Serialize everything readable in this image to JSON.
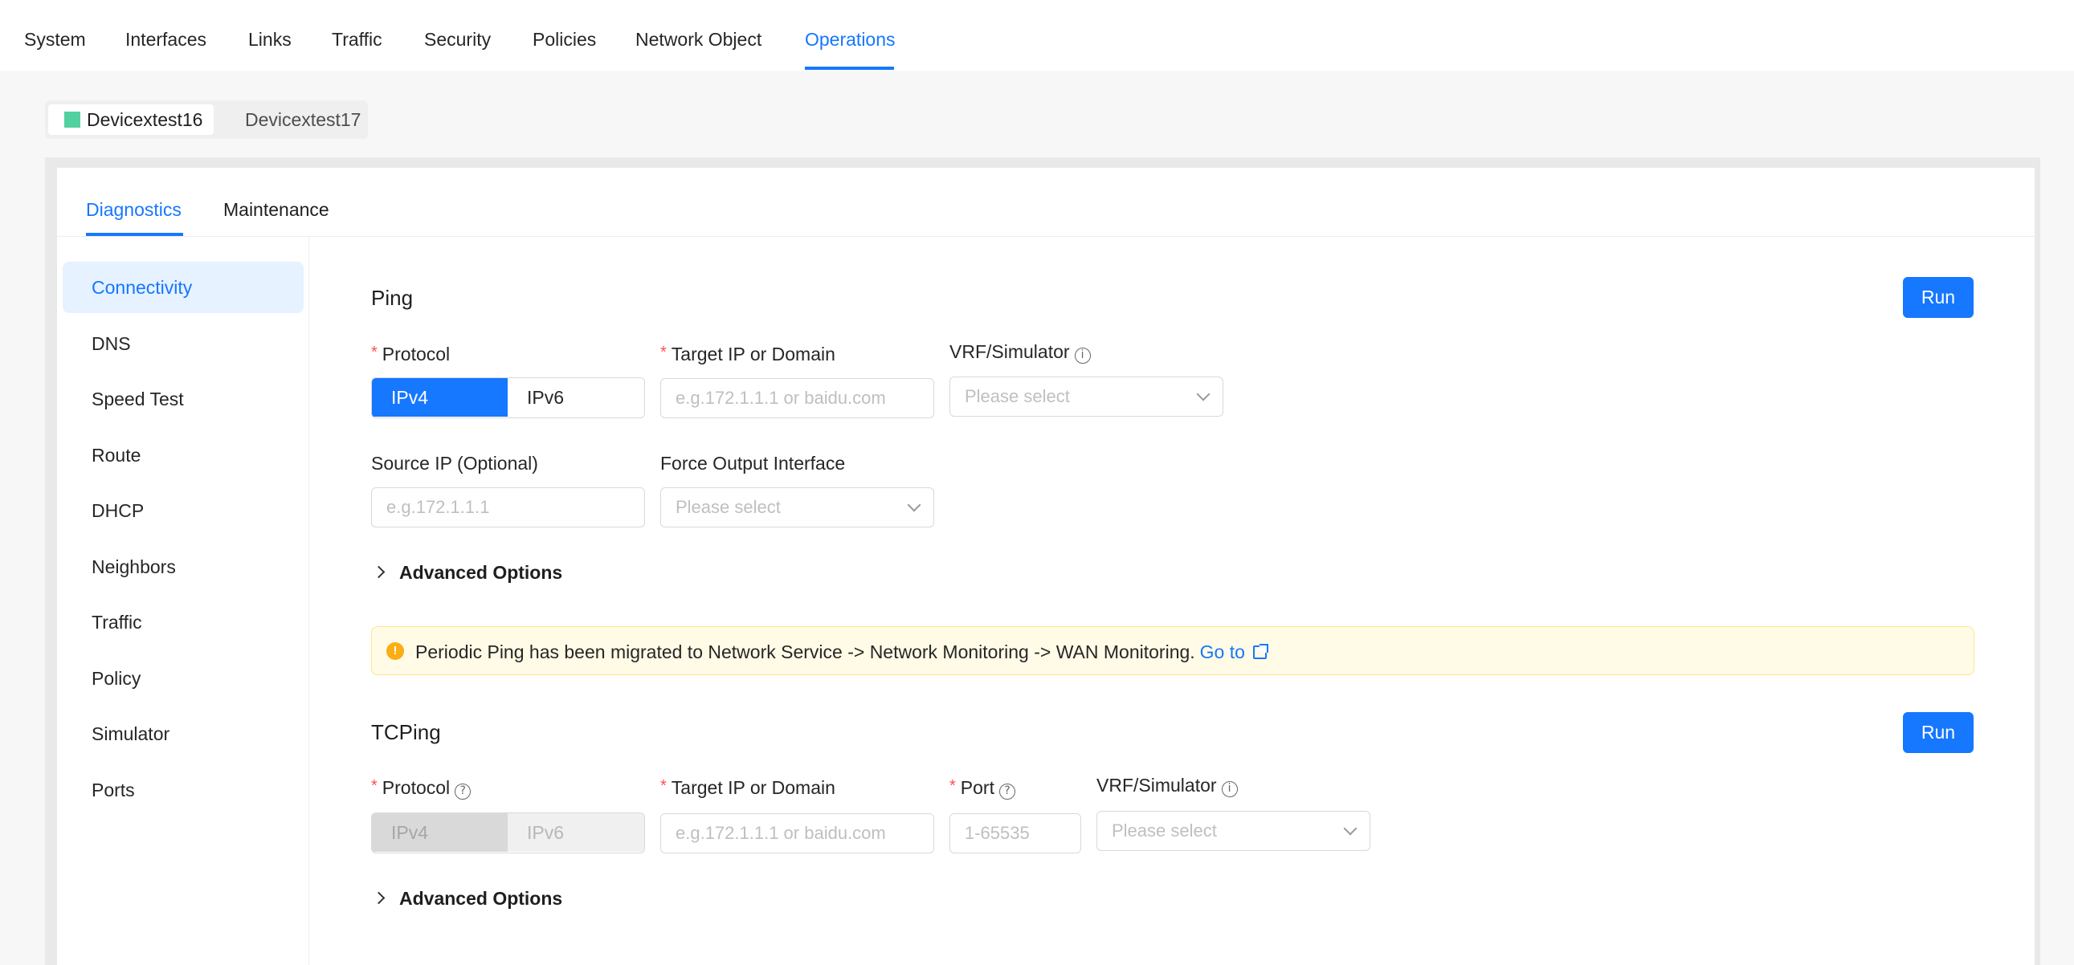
{
  "topnav": {
    "items": [
      "System",
      "Interfaces",
      "Links",
      "Traffic",
      "Security",
      "Policies",
      "Network Object",
      "Operations"
    ],
    "active": "Operations"
  },
  "devices": [
    "Devicextest16",
    "Devicextest17"
  ],
  "subtabs": [
    "Diagnostics",
    "Maintenance"
  ],
  "sidebar": [
    "Connectivity",
    "DNS",
    "Speed Test",
    "Route",
    "DHCP",
    "Neighbors",
    "Traffic",
    "Policy",
    "Simulator",
    "Ports"
  ],
  "ping": {
    "title": "Ping",
    "run": "Run",
    "protocol_label": "Protocol",
    "protocol_options": [
      "IPv4",
      "IPv6"
    ],
    "protocol_selected": "IPv4",
    "target_label": "Target IP or Domain",
    "target_placeholder": "e.g.172.1.1.1 or baidu.com",
    "vrf_label": "VRF/Simulator",
    "vrf_placeholder": "Please select",
    "source_label": "Source IP (Optional)",
    "source_placeholder": "e.g.172.1.1.1",
    "force_label": "Force Output Interface",
    "force_placeholder": "Please select",
    "advanced": "Advanced Options"
  },
  "alert": {
    "text": "Periodic Ping has been migrated to Network Service -> Network Monitoring -> WAN Monitoring.",
    "link": "Go to"
  },
  "tcping": {
    "title": "TCPing",
    "run": "Run",
    "protocol_label": "Protocol",
    "protocol_options": [
      "IPv4",
      "IPv6"
    ],
    "target_label": "Target IP or Domain",
    "target_placeholder": "e.g.172.1.1.1 or baidu.com",
    "port_label": "Port",
    "port_placeholder": "1-65535",
    "vrf_label": "VRF/Simulator",
    "vrf_placeholder": "Please select",
    "advanced": "Advanced Options"
  },
  "colors": {
    "accent": "#1677ff",
    "device_status": "#52d1a0",
    "warning": "#faad14"
  }
}
